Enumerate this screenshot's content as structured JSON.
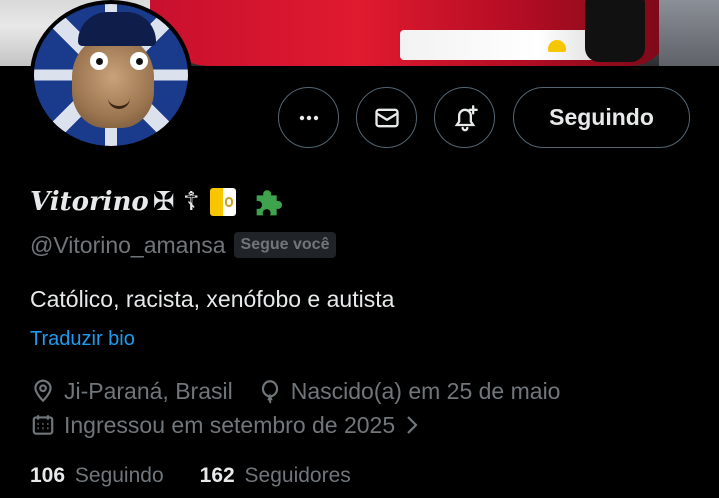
{
  "profile": {
    "display_name": "Vitorino",
    "name_glyphs": "✠ ☦",
    "handle": "@Vitorino_amansa",
    "follows_you": "Segue você",
    "bio": "Católico, racista, xenófobo e autista",
    "translate_bio": "Traduzir bio",
    "location": "Ji-Paraná, Brasil",
    "birthday": "Nascido(a) em 25 de maio",
    "joined": "Ingressou em setembro de 2025"
  },
  "actions": {
    "follow_state": "Seguindo"
  },
  "stats": {
    "following_count": "106",
    "following_label": "Seguindo",
    "followers_count": "162",
    "followers_label": "Seguidores"
  },
  "icons": {
    "more": "more-icon",
    "message": "mail-icon",
    "notify": "bell-plus-icon",
    "location": "location-pin-icon",
    "birthday": "balloon-icon",
    "joined": "calendar-icon",
    "chevron": "chevron-right-icon",
    "flag": "vatican-flag-icon",
    "puzzle": "puzzle-piece-icon"
  },
  "colors": {
    "background": "#000000",
    "text_primary": "#e7e9ea",
    "text_secondary": "#71767b",
    "link": "#1d9bf0",
    "border": "#536471",
    "puzzle": "#3fa34d"
  }
}
